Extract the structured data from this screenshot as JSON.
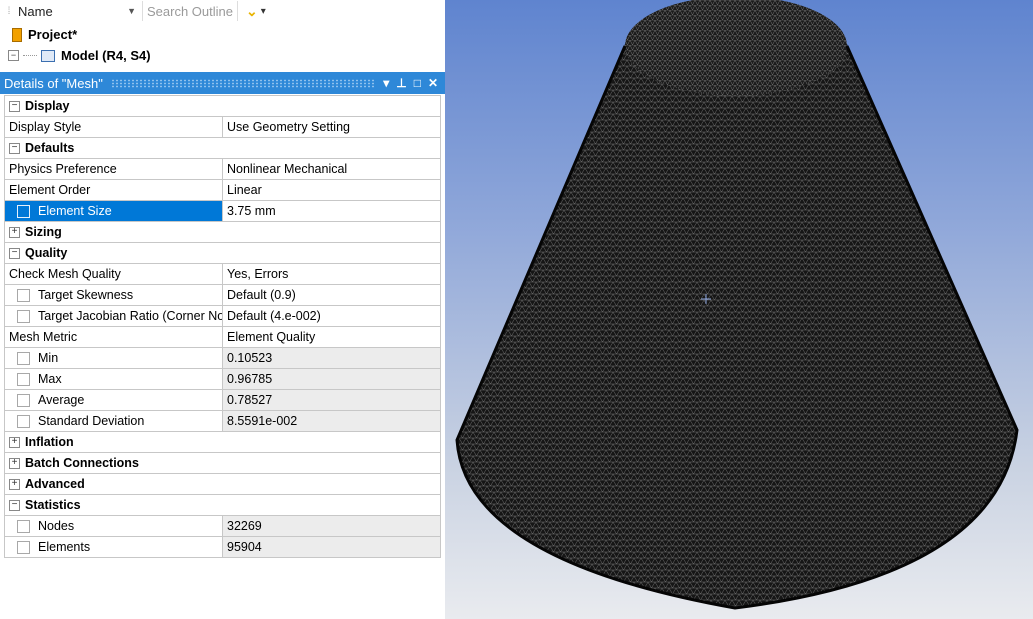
{
  "toolbar": {
    "name_label": "Name",
    "search_placeholder": "Search Outline"
  },
  "tree": {
    "project": "Project*",
    "model": "Model (R4, S4)"
  },
  "panel": {
    "title": "Details of \"Mesh\"",
    "controls": [
      "▾",
      "⊥",
      "□",
      "✕"
    ]
  },
  "details": {
    "display": {
      "group": "Display",
      "display_style": {
        "label": "Display Style",
        "value": "Use Geometry Setting"
      }
    },
    "defaults": {
      "group": "Defaults",
      "physics_preference": {
        "label": "Physics Preference",
        "value": "Nonlinear Mechanical"
      },
      "element_order": {
        "label": "Element Order",
        "value": "Linear"
      },
      "element_size": {
        "label": "Element Size",
        "value": "3.75 mm"
      }
    },
    "sizing": {
      "group": "Sizing"
    },
    "quality": {
      "group": "Quality",
      "check_mesh_quality": {
        "label": "Check Mesh Quality",
        "value": "Yes, Errors"
      },
      "target_skewness": {
        "label": "Target Skewness",
        "value": "Default (0.9)"
      },
      "target_jacobian": {
        "label": "Target Jacobian Ratio (Corner Nodes)",
        "value": "Default (4.e-002)"
      },
      "mesh_metric": {
        "label": "Mesh Metric",
        "value": "Element Quality"
      },
      "min": {
        "label": "Min",
        "value": "0.10523"
      },
      "max": {
        "label": "Max",
        "value": "0.96785"
      },
      "average": {
        "label": "Average",
        "value": "0.78527"
      },
      "std_dev": {
        "label": "Standard Deviation",
        "value": "8.5591e-002"
      }
    },
    "inflation": {
      "group": "Inflation"
    },
    "batch_connections": {
      "group": "Batch Connections"
    },
    "advanced": {
      "group": "Advanced"
    },
    "statistics": {
      "group": "Statistics",
      "nodes": {
        "label": "Nodes",
        "value": "32269"
      },
      "elements": {
        "label": "Elements",
        "value": "95904"
      }
    }
  },
  "expanders": {
    "minus": "−",
    "plus": "+"
  },
  "colors": {
    "panel_header": "#2e88d8",
    "selection": "#0078d7",
    "viewport_top": "#5f84cf",
    "viewport_bottom": "#e9ebef",
    "mesh_body": "#161616",
    "mesh_lines": "#8a8a8a"
  }
}
